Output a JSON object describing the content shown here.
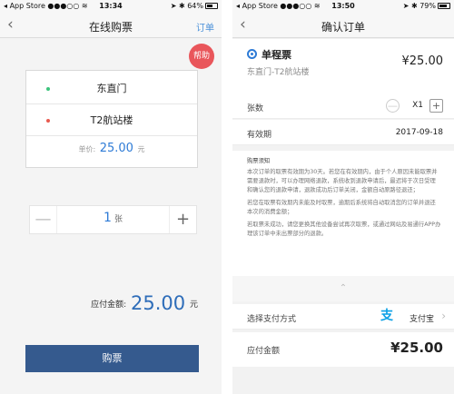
{
  "left": {
    "status": {
      "carrier": "App Store",
      "time": "13:34",
      "battery": "64%",
      "battery_level": 0.64
    },
    "nav": {
      "back": "‹",
      "title": "在线购票",
      "action": "订单"
    },
    "help_label": "帮助",
    "route": {
      "from": "东直门",
      "to": "T2航站楼",
      "from_dot_color": "#3cc47c",
      "to_dot_color": "#e85a4f",
      "unit_price_label": "单价:",
      "unit_price": "25.00",
      "unit_price_currency": "元"
    },
    "stepper": {
      "minus": "—",
      "value": "1",
      "unit": "张",
      "plus": "+"
    },
    "total": {
      "label": "应付金额:",
      "amount": "25.00",
      "unit": "元"
    },
    "buy_label": "购票"
  },
  "right": {
    "status": {
      "carrier": "App Store",
      "time": "13:50",
      "battery": "79%",
      "battery_level": 0.79
    },
    "nav": {
      "back": "‹",
      "title": "确认订单"
    },
    "ticket": {
      "name": "单程票",
      "route": "东直门-T2航站楼",
      "price": "¥25.00"
    },
    "count": {
      "label": "张数",
      "minus": "—",
      "value": "X1",
      "plus": "+"
    },
    "validity": {
      "label": "有效期",
      "date": "2017-09-18"
    },
    "notice": {
      "title": "购票须知",
      "p1": "本次订单的取票有效期为30天。若您在有效期内，由于个人原因未能取票并需要退款时，可以办理网络退款，系统收到退款申请后，最迟将于次日受理和确认您的退款申请，退款成功后订单关闭，金额自动原路径退还；",
      "p2": "若您在取票有效期内未能及时取票，逾期后系统将自动取消您的订单并退还本次的消费金额；",
      "p3": "若取票未成功，请您更换其他设备尝试再次取票，或通过网站及易通行APP办理该订单中未出票部分的退款。"
    },
    "collapse": "⌃",
    "payment": {
      "label": "选择支付方式",
      "icon_char": "支",
      "method": "支付宝",
      "chevron": "›"
    },
    "total": {
      "label": "应付金额",
      "amount": "¥25.00"
    }
  },
  "colors": {
    "accent_blue": "#2e7bd6",
    "button_blue": "#355a8e",
    "help_red": "#e9565b",
    "alipay_blue": "#0ba0e6"
  },
  "icons": {
    "back": "chevron-left-icon",
    "help": "help-badge",
    "location_apply": "location-arrow-icon",
    "alipay": "alipay-icon",
    "ticket": "ticket-circle-icon",
    "collapse": "chevron-up-icon"
  }
}
